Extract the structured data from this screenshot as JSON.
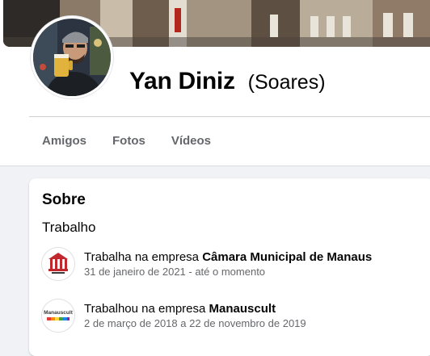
{
  "profile": {
    "name": "Yan Diniz",
    "alternate_name": "(Soares)"
  },
  "tabs": [
    {
      "label": "Amigos"
    },
    {
      "label": "Fotos"
    },
    {
      "label": "Vídeos"
    }
  ],
  "about": {
    "title": "Sobre",
    "section": "Trabalho",
    "work": [
      {
        "prefix": "Trabalha na empresa",
        "company": "Câmara Municipal de Manaus",
        "dates": "31 de janeiro de 2021 - até o momento",
        "logo_icon": "camara-municipal-logo-icon"
      },
      {
        "prefix": "Trabalhou na empresa",
        "company": "Manauscult",
        "dates": "2 de março de 2018 a 22 de novembro de 2019",
        "logo_icon": "manauscult-logo-icon",
        "logo_text": "Manauscult"
      }
    ]
  },
  "colors": {
    "text_primary": "#050505",
    "text_secondary": "#65676b",
    "page_background": "#f0f2f5",
    "card_background": "#ffffff"
  }
}
